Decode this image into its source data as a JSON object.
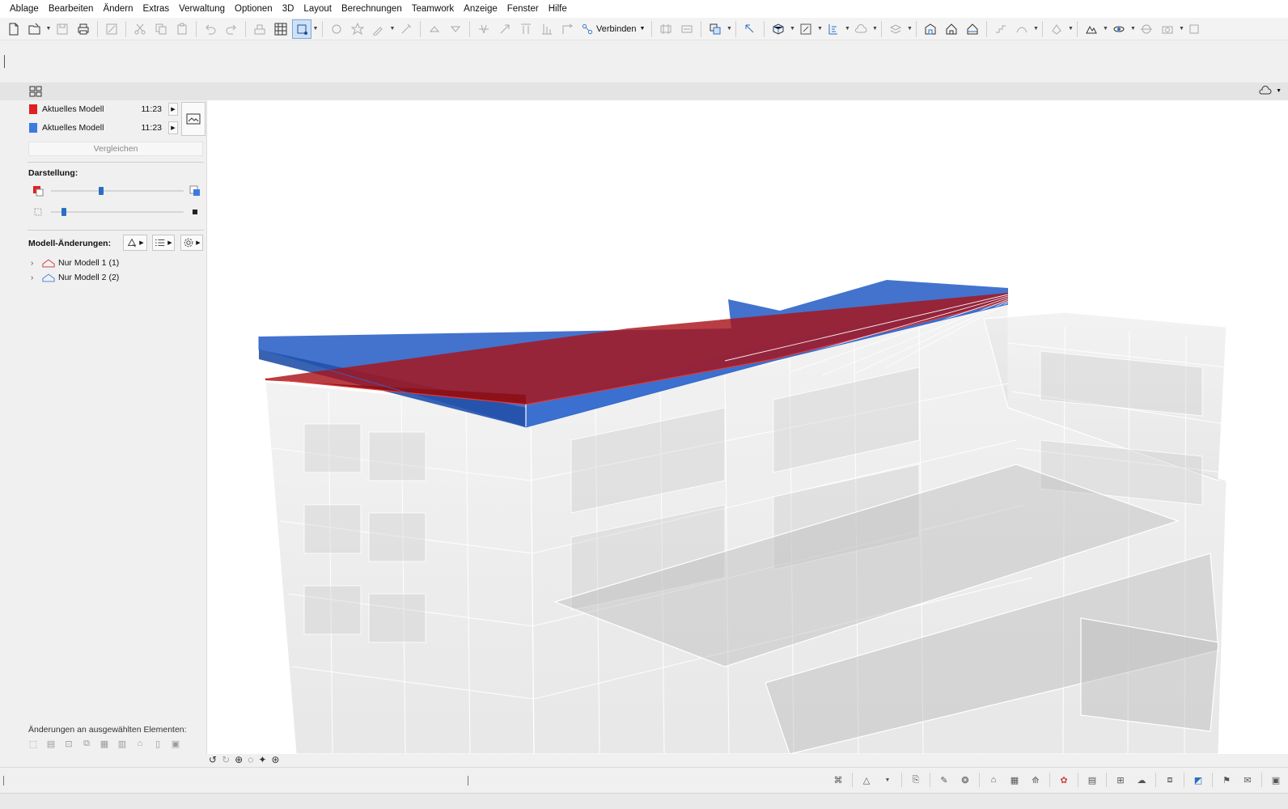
{
  "menu": [
    "Ablage",
    "Bearbeiten",
    "Ändern",
    "Extras",
    "Verwaltung",
    "Optionen",
    "3D",
    "Layout",
    "Berechnungen",
    "Teamwork",
    "Anzeige",
    "Fenster",
    "Hilfe"
  ],
  "toolbar": {
    "connect_label": "Verbinden"
  },
  "compare": {
    "models": [
      {
        "name": "Aktuelles Modell",
        "time": "11:23",
        "color": "#e02020"
      },
      {
        "name": "Aktuelles Modell",
        "time": "11:23",
        "color": "#3b7be0"
      }
    ],
    "compare_button": "Vergleichen",
    "display_title": "Darstellung:",
    "slider_overlay": 0.38,
    "slider_transparency": 0.1,
    "changes_title": "Modell-Änderungen:",
    "tree": [
      {
        "label": "Nur Modell 1 (1)",
        "color": "#d03030"
      },
      {
        "label": "Nur Modell 2 (2)",
        "color": "#3b7be0"
      }
    ],
    "selected_changes_label": "Änderungen an ausgewählten Elementen:"
  },
  "colors": {
    "model1": "#c0141c",
    "model2": "#2f64c8",
    "accent": "#2a6fc4"
  }
}
